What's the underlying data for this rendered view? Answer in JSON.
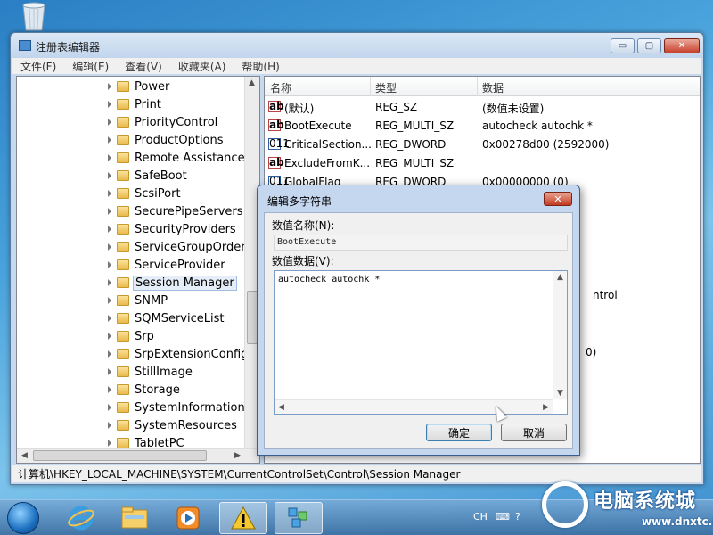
{
  "window": {
    "title": "注册表编辑器",
    "min_label": "▭",
    "max_label": "▢",
    "close_label": "✕"
  },
  "menu": [
    "文件(F)",
    "编辑(E)",
    "查看(V)",
    "收藏夹(A)",
    "帮助(H)"
  ],
  "tree": {
    "items": [
      "Power",
      "Print",
      "PriorityControl",
      "ProductOptions",
      "Remote Assistance",
      "SafeBoot",
      "ScsiPort",
      "SecurePipeServers",
      "SecurityProviders",
      "ServiceGroupOrder",
      "ServiceProvider",
      "Session Manager",
      "SNMP",
      "SQMServiceList",
      "Srp",
      "SrpExtensionConfig",
      "StillImage",
      "Storage",
      "SystemInformation",
      "SystemResources",
      "TabletPC"
    ],
    "selected_index": 11
  },
  "list": {
    "headers": [
      "名称",
      "类型",
      "数据"
    ],
    "rows": [
      {
        "icon": "string-value-icon",
        "name": "(默认)",
        "type": "REG_SZ",
        "data": "(数值未设置)"
      },
      {
        "icon": "string-value-icon",
        "name": "BootExecute",
        "type": "REG_MULTI_SZ",
        "data": "autocheck autochk *"
      },
      {
        "icon": "binary-value-icon",
        "name": "CriticalSection...",
        "type": "REG_DWORD",
        "data": "0x00278d00 (2592000)"
      },
      {
        "icon": "string-value-icon",
        "name": "ExcludeFromK...",
        "type": "REG_MULTI_SZ",
        "data": ""
      },
      {
        "icon": "binary-value-icon",
        "name": "GlobalFlag",
        "type": "REG_DWORD",
        "data": "0x00000000 (0)"
      }
    ],
    "partial_text": [
      "ntrol",
      "0)"
    ]
  },
  "status_path": "计算机\\HKEY_LOCAL_MACHINE\\SYSTEM\\CurrentControlSet\\Control\\Session Manager",
  "dialog": {
    "title": "编辑多字符串",
    "name_label": "数值名称(N):",
    "name_value": "BootExecute",
    "data_label": "数值数据(V):",
    "data_value": "autocheck autochk *",
    "ok_label": "确定",
    "cancel_label": "取消",
    "close_label": "✕"
  },
  "taskbar": {
    "lang": "CH",
    "tray_icons": [
      "keyboard-icon",
      "help-icon",
      "flag-icon",
      "network-icon",
      "volume-icon"
    ]
  },
  "watermark": {
    "title": "电脑系统城",
    "url": "www.dnxtc.net"
  }
}
